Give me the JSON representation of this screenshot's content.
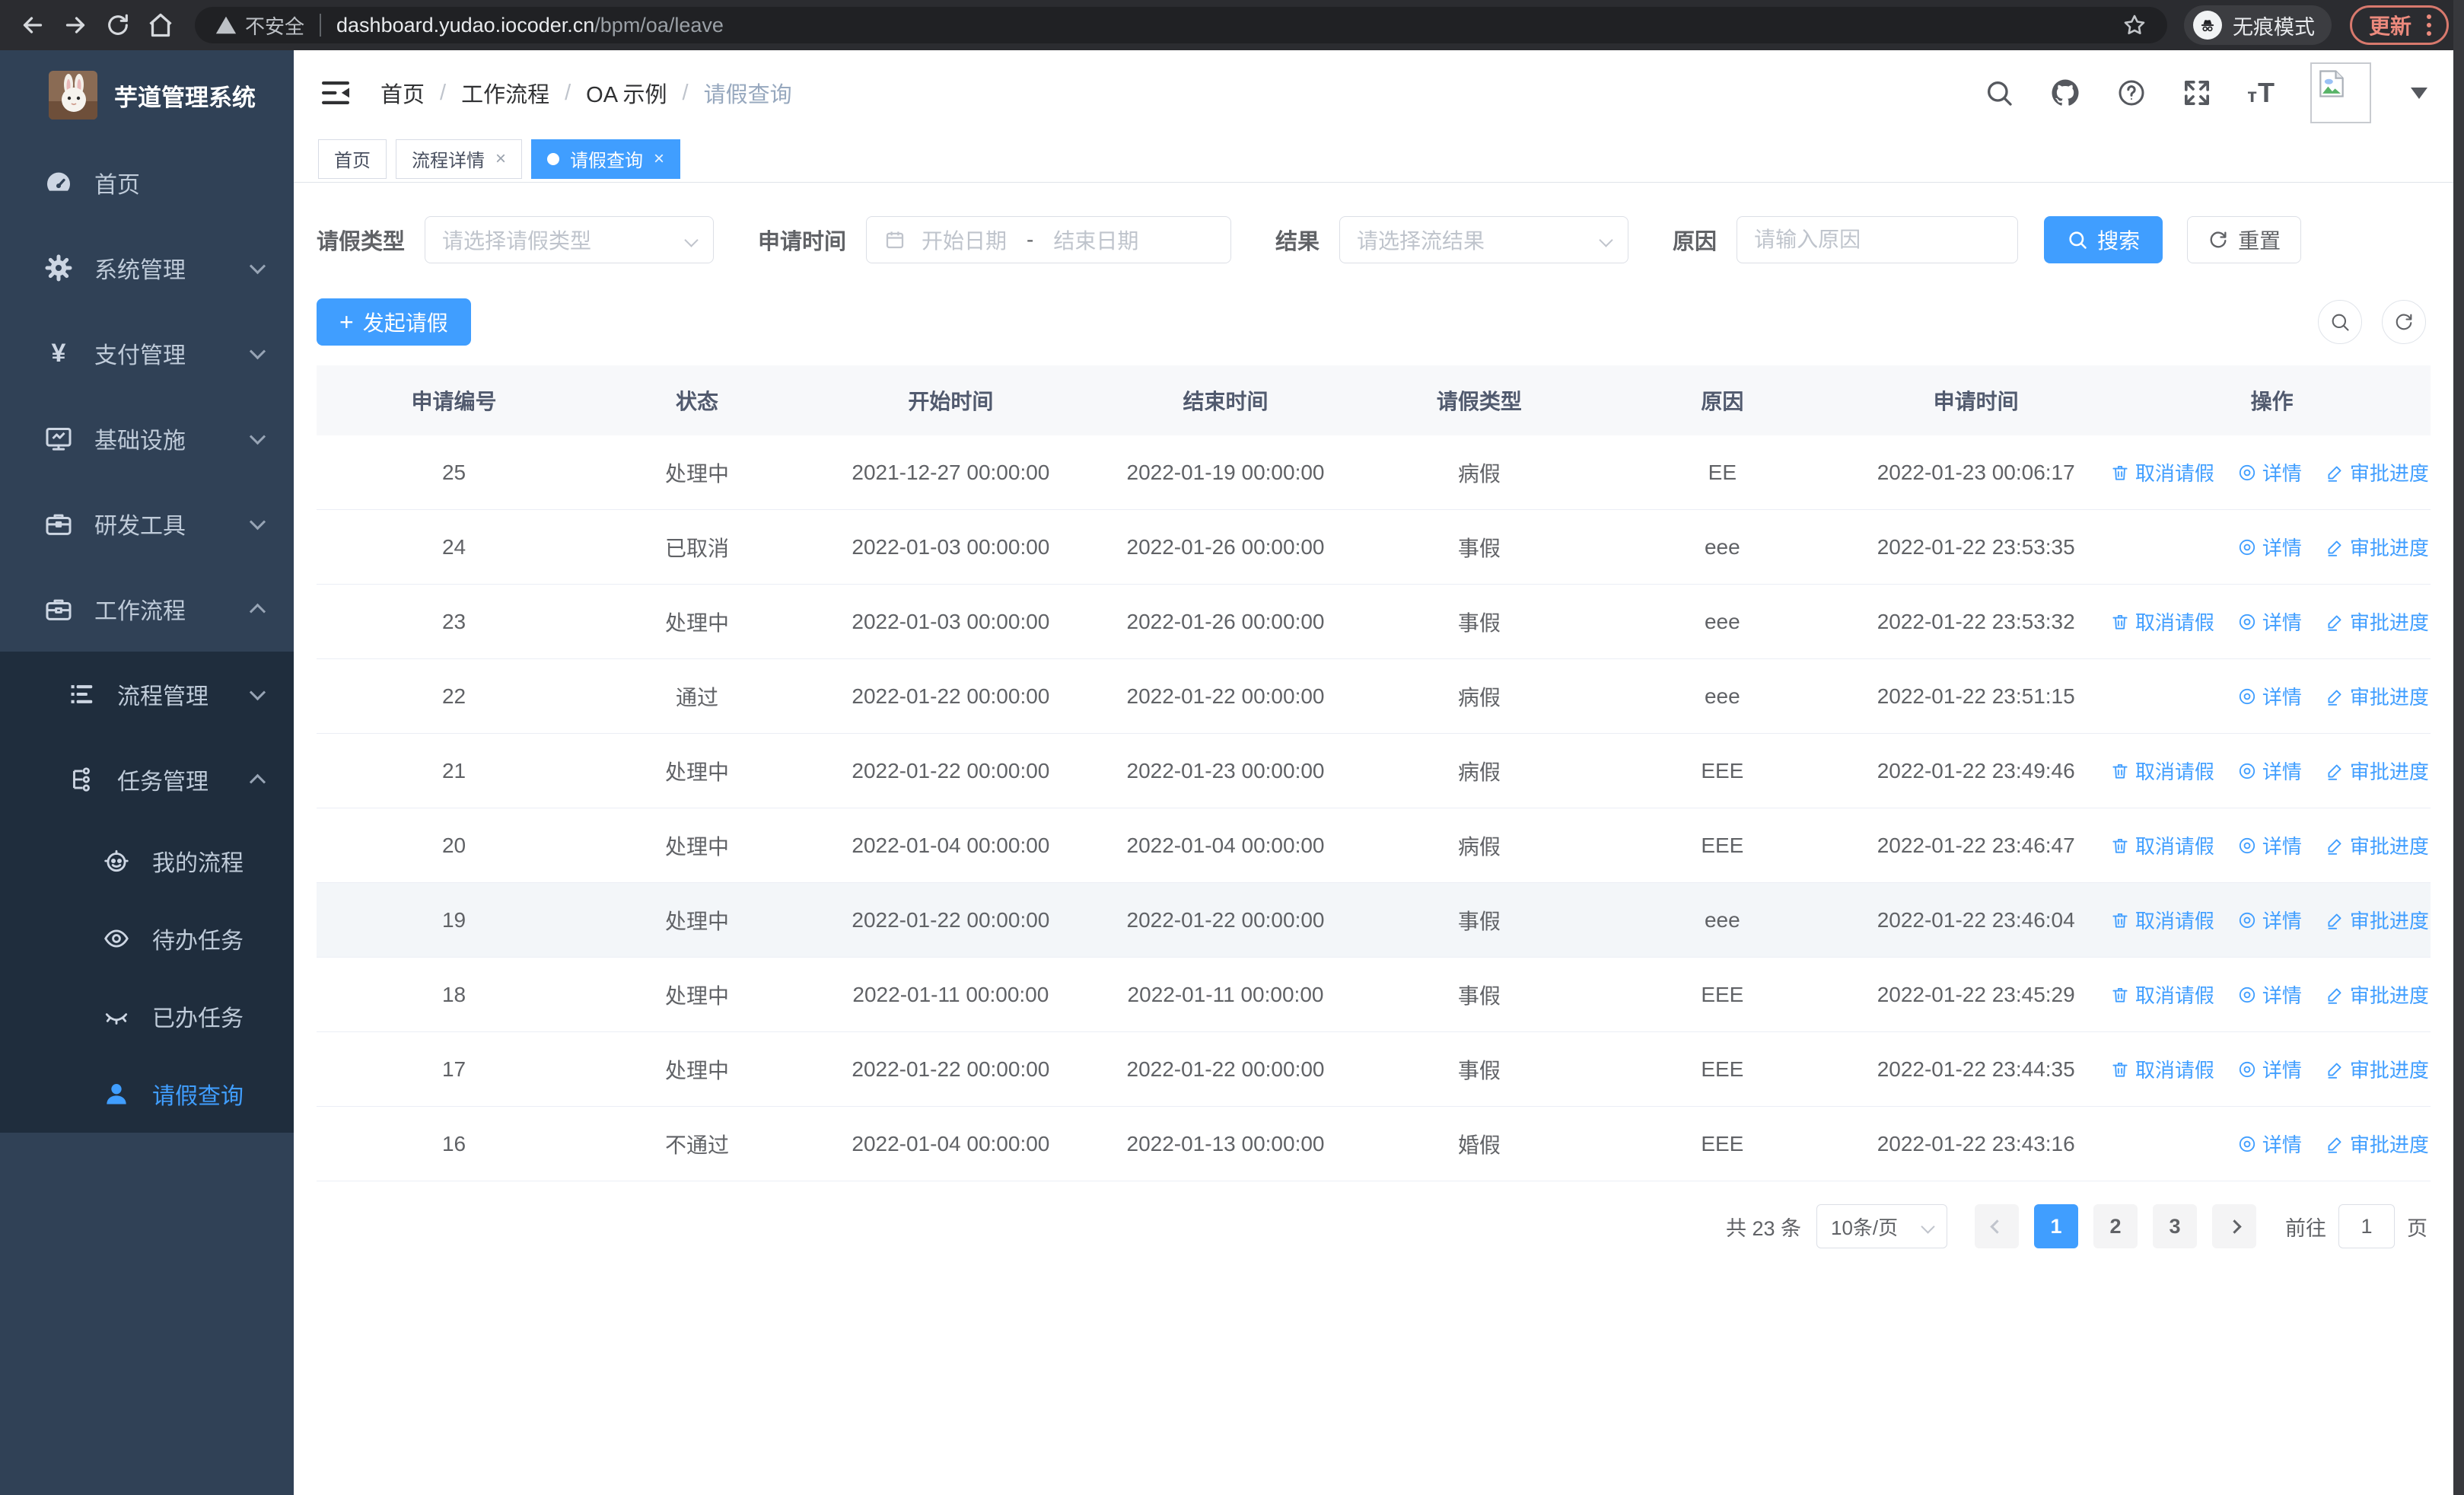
{
  "colors": {
    "accent": "#409eff",
    "chrome_update": "#ec8a7d",
    "sidebar_bg": "#304156",
    "submenu_bg": "#1f2d3d"
  },
  "browser": {
    "security_label": "不安全",
    "url_host": "dashboard.yudao.iocoder.cn",
    "url_path": "/bpm/oa/leave",
    "incognito_label": "无痕模式",
    "update_label": "更新"
  },
  "sidebar": {
    "title": "芋道管理系统",
    "home": "首页",
    "system": "系统管理",
    "payment": "支付管理",
    "infra": "基础设施",
    "devtools": "研发工具",
    "workflow": "工作流程",
    "process_mgmt": "流程管理",
    "task_mgmt": "任务管理",
    "my_process": "我的流程",
    "todo_tasks": "待办任务",
    "done_tasks": "已办任务",
    "leave_query": "请假查询"
  },
  "header": {
    "breadcrumb": [
      "首页",
      "工作流程",
      "OA 示例",
      "请假查询"
    ]
  },
  "tags": {
    "t1": "首页",
    "t2": "流程详情",
    "t3": "请假查询",
    "close": "×"
  },
  "filters": {
    "leave_type_label": "请假类型",
    "leave_type_placeholder": "请选择请假类型",
    "apply_time_label": "申请时间",
    "start_placeholder": "开始日期",
    "range_separator": "-",
    "end_placeholder": "结束日期",
    "result_label": "结果",
    "result_placeholder": "请选择流结果",
    "reason_label": "原因",
    "reason_placeholder": "请输入原因",
    "search_label": "搜索",
    "reset_label": "重置"
  },
  "toolbar": {
    "create_label": "发起请假",
    "plus": "+"
  },
  "table": {
    "columns": [
      "申请编号",
      "状态",
      "开始时间",
      "结束时间",
      "请假类型",
      "原因",
      "申请时间",
      "操作"
    ],
    "action_labels": {
      "cancel": "取消请假",
      "detail": "详情",
      "progress": "审批进度"
    },
    "rows": [
      {
        "id": "25",
        "status": "处理中",
        "start": "2021-12-27 00:00:00",
        "end": "2022-01-19 00:00:00",
        "type": "病假",
        "reason": "EE",
        "applied": "2022-01-23 00:06:17",
        "actions": [
          "cancel",
          "detail",
          "progress"
        ]
      },
      {
        "id": "24",
        "status": "已取消",
        "start": "2022-01-03 00:00:00",
        "end": "2022-01-26 00:00:00",
        "type": "事假",
        "reason": "eee",
        "applied": "2022-01-22 23:53:35",
        "actions": [
          "detail",
          "progress"
        ]
      },
      {
        "id": "23",
        "status": "处理中",
        "start": "2022-01-03 00:00:00",
        "end": "2022-01-26 00:00:00",
        "type": "事假",
        "reason": "eee",
        "applied": "2022-01-22 23:53:32",
        "actions": [
          "cancel",
          "detail",
          "progress"
        ]
      },
      {
        "id": "22",
        "status": "通过",
        "start": "2022-01-22 00:00:00",
        "end": "2022-01-22 00:00:00",
        "type": "病假",
        "reason": "eee",
        "applied": "2022-01-22 23:51:15",
        "actions": [
          "detail",
          "progress"
        ]
      },
      {
        "id": "21",
        "status": "处理中",
        "start": "2022-01-22 00:00:00",
        "end": "2022-01-23 00:00:00",
        "type": "病假",
        "reason": "EEE",
        "applied": "2022-01-22 23:49:46",
        "actions": [
          "cancel",
          "detail",
          "progress"
        ]
      },
      {
        "id": "20",
        "status": "处理中",
        "start": "2022-01-04 00:00:00",
        "end": "2022-01-04 00:00:00",
        "type": "病假",
        "reason": "EEE",
        "applied": "2022-01-22 23:46:47",
        "actions": [
          "cancel",
          "detail",
          "progress"
        ]
      },
      {
        "id": "19",
        "status": "处理中",
        "start": "2022-01-22 00:00:00",
        "end": "2022-01-22 00:00:00",
        "type": "事假",
        "reason": "eee",
        "applied": "2022-01-22 23:46:04",
        "actions": [
          "cancel",
          "detail",
          "progress"
        ],
        "highlight": true
      },
      {
        "id": "18",
        "status": "处理中",
        "start": "2022-01-11 00:00:00",
        "end": "2022-01-11 00:00:00",
        "type": "事假",
        "reason": "EEE",
        "applied": "2022-01-22 23:45:29",
        "actions": [
          "cancel",
          "detail",
          "progress"
        ]
      },
      {
        "id": "17",
        "status": "处理中",
        "start": "2022-01-22 00:00:00",
        "end": "2022-01-22 00:00:00",
        "type": "事假",
        "reason": "EEE",
        "applied": "2022-01-22 23:44:35",
        "actions": [
          "cancel",
          "detail",
          "progress"
        ]
      },
      {
        "id": "16",
        "status": "不通过",
        "start": "2022-01-04 00:00:00",
        "end": "2022-01-13 00:00:00",
        "type": "婚假",
        "reason": "EEE",
        "applied": "2022-01-22 23:43:16",
        "actions": [
          "detail",
          "progress"
        ]
      }
    ]
  },
  "pagination": {
    "total_label": "共 23 条",
    "page_size_label": "10条/页",
    "pages": [
      "1",
      "2",
      "3"
    ],
    "goto_prefix": "前往",
    "goto_value": "1",
    "goto_suffix": "页"
  }
}
